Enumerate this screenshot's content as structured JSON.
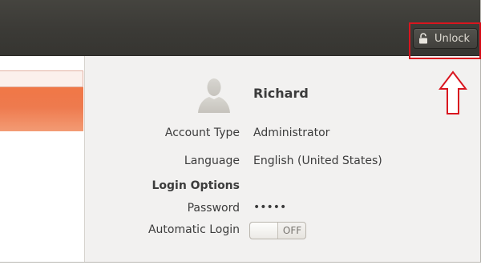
{
  "header": {
    "unlock_label": "Unlock",
    "lock_icon": "padlock-open-icon"
  },
  "annotation": {
    "arrow_icon": "up-arrow-icon",
    "highlight_color": "#d9151f"
  },
  "sidebar": {
    "selected_color": "#f07746"
  },
  "user": {
    "avatar_icon": "user-silhouette-icon",
    "name": "Richard"
  },
  "details": {
    "account_type_label": "Account Type",
    "account_type_value": "Administrator",
    "language_label": "Language",
    "language_value": "English (United States)",
    "login_options_label": "Login Options",
    "password_label": "Password",
    "password_value": "•••••",
    "automatic_login_label": "Automatic Login",
    "automatic_login_state": "OFF"
  }
}
